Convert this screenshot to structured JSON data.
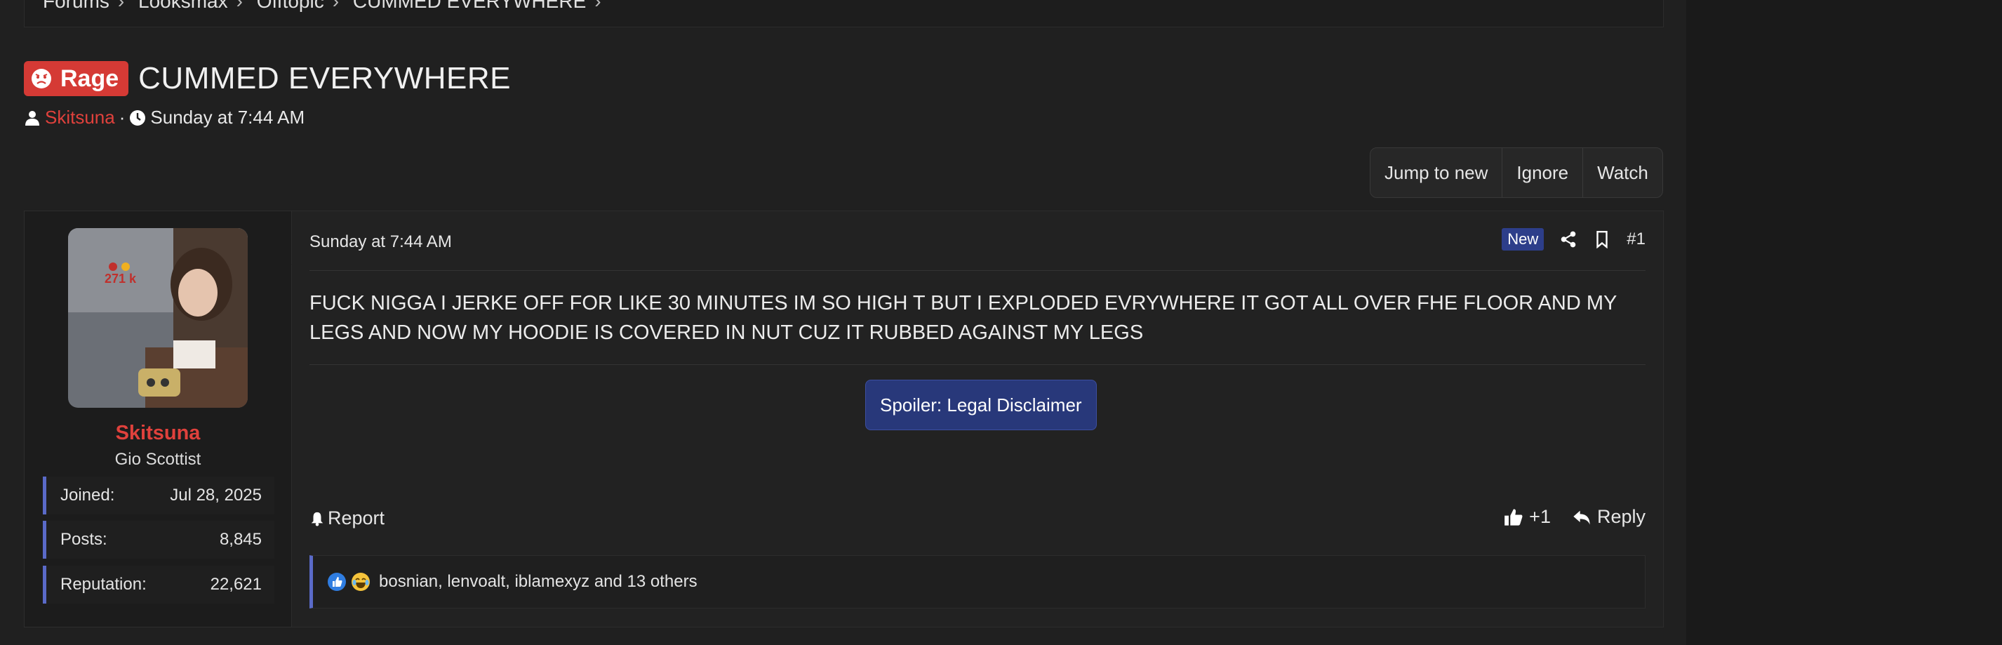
{
  "breadcrumbs": [
    "Forums",
    "Looksmax",
    "Offtopic",
    "CUMMED EVERYWHERE"
  ],
  "thread": {
    "prefix": "Rage",
    "title": "CUMMED EVERYWHERE",
    "author": "Skitsuna",
    "meta_sep": "·",
    "date": "Sunday at 7:44 AM"
  },
  "thread_buttons": [
    "Jump to new",
    "Ignore",
    "Watch"
  ],
  "user": {
    "name": "Skitsuna",
    "title": "Gio Scottist",
    "avatar_overlay": "271 k",
    "stats": [
      {
        "label": "Joined:",
        "value": "Jul 28, 2025"
      },
      {
        "label": "Posts:",
        "value": "8,845"
      },
      {
        "label": "Reputation:",
        "value": "22,621"
      }
    ]
  },
  "post": {
    "date": "Sunday at 7:44 AM",
    "new_badge": "New",
    "number": "#1",
    "body": "FUCK NIGGA I JERKE OFF FOR LIKE 30 MINUTES IM SO HIGH T BUT I EXPLODED EVRYWHERE IT GOT ALL OVER FHE FLOOR AND MY LEGS AND NOW MY HOODIE IS COVERED IN NUT CUZ IT RUBBED AGAINST MY LEGS",
    "spoiler": "Spoiler: Legal Disclaimer",
    "report": "Report",
    "like": "+1",
    "reply": "Reply",
    "reactions": "bosnian, lenvoalt, iblamexyz and 13 others"
  },
  "colors": {
    "accent_red": "#e0413c",
    "prefix_bg": "#d53a35",
    "spoiler_bg": "#28387a",
    "stat_border": "#5a6ac8"
  },
  "icons": [
    "user-icon",
    "clock-icon",
    "share-icon",
    "bookmark-icon",
    "bell-icon",
    "thumbs-up-icon",
    "reply-icon",
    "angry-face-icon"
  ]
}
